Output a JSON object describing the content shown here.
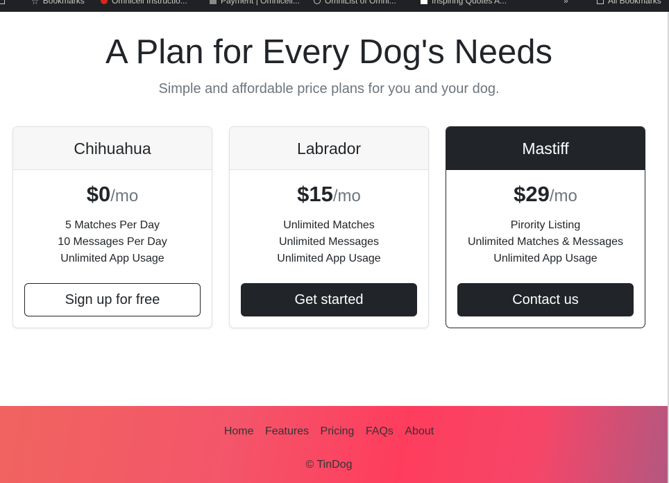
{
  "bookmarks_bar": {
    "items": [
      {
        "label": "Bookmarks",
        "icon": "star-icon"
      },
      {
        "label": "Omnicell Instructio...",
        "icon": "red-circle-icon"
      },
      {
        "label": "Payment | Omnicell...",
        "icon": "page-icon"
      },
      {
        "label": "OmniList of Omni...",
        "icon": "globe-icon"
      },
      {
        "label": "Inspiring Quotes A...",
        "icon": "b-icon"
      },
      {
        "label": "All Bookmarks",
        "icon": "folder-icon"
      }
    ],
    "overflow": "»"
  },
  "pricing": {
    "title": "A Plan for Every Dog's Needs",
    "subtitle": "Simple and affordable price plans for you and your dog.",
    "plans": [
      {
        "name": "Chihuahua",
        "price": "$0",
        "period": "/mo",
        "features": [
          "5 Matches Per Day",
          "10 Messages Per Day",
          "Unlimited App Usage"
        ],
        "cta": "Sign up for free"
      },
      {
        "name": "Labrador",
        "price": "$15",
        "period": "/mo",
        "features": [
          "Unlimited Matches",
          "Unlimited Messages",
          "Unlimited App Usage"
        ],
        "cta": "Get started"
      },
      {
        "name": "Mastiff",
        "price": "$29",
        "period": "/mo",
        "features": [
          "Pirority Listing",
          "Unlimited Matches & Messages",
          "Unlimited App Usage"
        ],
        "cta": "Contact us"
      }
    ]
  },
  "footer": {
    "links": [
      "Home",
      "Features",
      "Pricing",
      "FAQs",
      "About"
    ],
    "copyright": "© TinDog"
  },
  "colors": {
    "dark": "#212529",
    "muted": "#6c757d",
    "footer_gradient_start": "#f0645f",
    "footer_gradient_mid": "#fe3d5d",
    "footer_gradient_end": "#b4577f"
  }
}
